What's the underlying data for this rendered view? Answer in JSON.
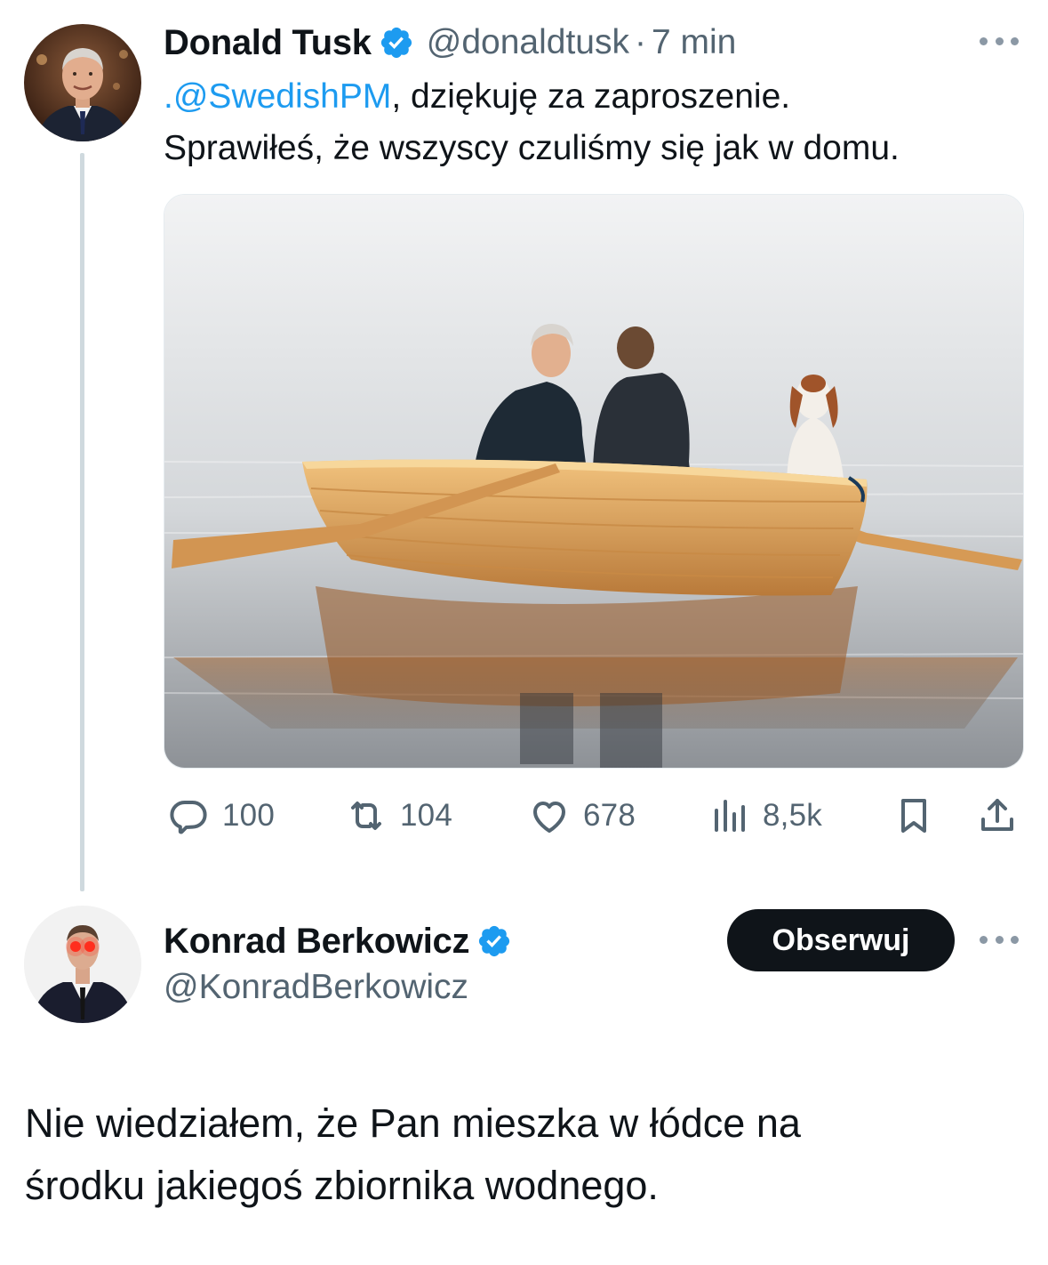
{
  "tweet": {
    "author_name": "Donald Tusk",
    "handle": "@donaldtusk",
    "separator": "·",
    "time": "7 min",
    "mention": ".@SwedishPM",
    "text_line1_rest": ", dziękuję za zaproszenie.",
    "text_line2": "Sprawiłeś, że wszyscy czuliśmy się jak w domu.",
    "stats": {
      "replies": "100",
      "reposts": "104",
      "likes": "678",
      "views": "8,5k"
    },
    "icons": {
      "reply": "reply-icon",
      "repost": "repost-icon",
      "like": "heart-icon",
      "views": "views-icon",
      "bookmark": "bookmark-icon",
      "share": "share-icon"
    }
  },
  "reply": {
    "author_name": "Konrad Berkowicz",
    "handle": "@KonradBerkowicz",
    "follow_label": "Obserwuj",
    "text_line1": "Nie wiedziałem, że Pan mieszka w łódce na",
    "text_line2": "środku jakiegoś zbiornika wodnego."
  },
  "colors": {
    "verified": "#1d9bf0",
    "mention": "#1d9bf0",
    "muted": "#536471",
    "follow_button": "#0f1419"
  }
}
